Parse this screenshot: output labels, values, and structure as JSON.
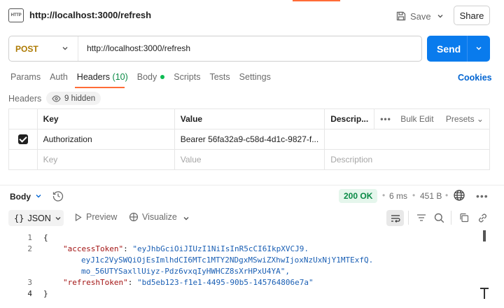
{
  "header": {
    "request_icon": "http-request-icon",
    "request_icon_text": "HTTP",
    "title": "http://localhost:3000/refresh",
    "save_label": "Save",
    "share_label": "Share"
  },
  "request": {
    "method": "POST",
    "url": "http://localhost:3000/refresh",
    "send_label": "Send"
  },
  "tabs": {
    "items": [
      {
        "label": "Params"
      },
      {
        "label": "Auth"
      },
      {
        "label": "Headers",
        "count": "(10)"
      },
      {
        "label": "Body"
      },
      {
        "label": "Scripts"
      },
      {
        "label": "Tests"
      },
      {
        "label": "Settings"
      }
    ],
    "active": "Headers",
    "cookies_label": "Cookies"
  },
  "headers_section": {
    "label": "Headers",
    "hidden_label": "9 hidden",
    "columns": {
      "key": "Key",
      "value": "Value",
      "description": "Descrip...",
      "bulk_edit": "Bulk Edit",
      "presets": "Presets"
    },
    "rows": [
      {
        "checked": true,
        "key": "Authorization",
        "value": "Bearer 56fa32a9-c58d-4d1c-9827-f...",
        "description": ""
      }
    ],
    "placeholder_row": {
      "key": "Key",
      "value": "Value",
      "description": "Description"
    }
  },
  "response": {
    "body_label": "Body",
    "status": "200 OK",
    "time": "6 ms",
    "size": "451 B",
    "format": "JSON",
    "preview_label": "Preview",
    "visualize_label": "Visualize",
    "code_lines": [
      {
        "n": "1",
        "text": "{"
      },
      {
        "n": "2",
        "key": "\"accessToken\"",
        "value": "\"eyJhbGciOiJIUzI1NiIsInR5cCI6IkpXVCJ9.",
        "cont1": "eyJ1c2VySWQiOjEsImlhdCI6MTc1MTY2NDgxMSwiZXhwIjoxNzUxNjY1MTExfQ.",
        "cont2": "mo_56UTYSaxllUiyz-Pdz6vxqIyHWHCZ8sXrHPxU4YA\","
      },
      {
        "n": "3",
        "key": "\"refreshToken\"",
        "value": "\"bd5eb123-f1e1-4495-90b5-145764806e7a\""
      },
      {
        "n": "4",
        "text": "}"
      }
    ]
  },
  "colors": {
    "accent": "#ff6c37",
    "send": "#097bed",
    "method": "#ad7a03",
    "status_green": "#0a8a46",
    "link_blue": "#0265d2"
  }
}
